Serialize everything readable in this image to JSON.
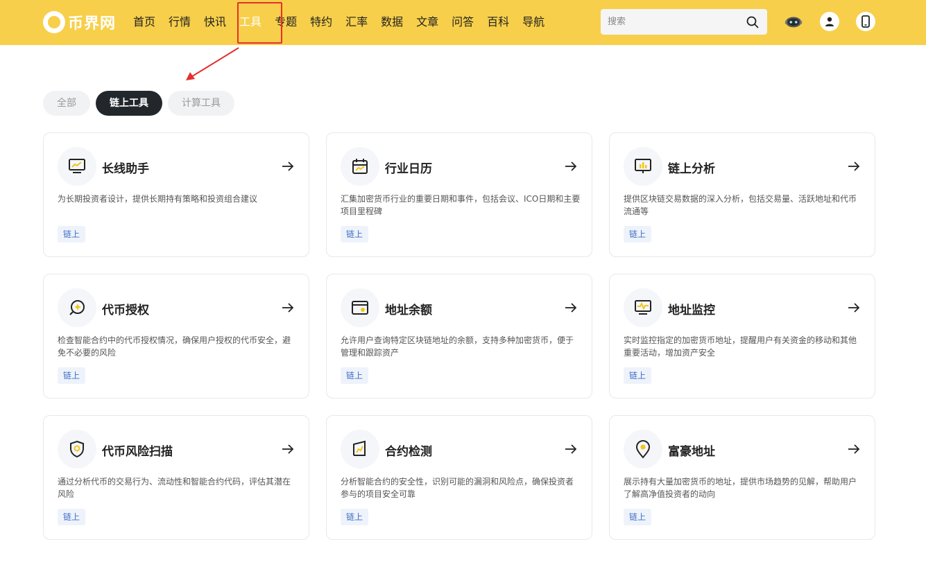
{
  "header": {
    "logo_text": "币界网",
    "nav": [
      {
        "label": "首页"
      },
      {
        "label": "行情"
      },
      {
        "label": "快讯"
      },
      {
        "label": "工具"
      },
      {
        "label": "专题"
      },
      {
        "label": "特约"
      },
      {
        "label": "汇率"
      },
      {
        "label": "数据"
      },
      {
        "label": "文章"
      },
      {
        "label": "问答"
      },
      {
        "label": "百科"
      },
      {
        "label": "导航"
      }
    ],
    "active_nav": "工具",
    "search_placeholder": "搜索",
    "icons": [
      "robot-icon",
      "user-icon",
      "mobile-icon"
    ]
  },
  "tabs": [
    {
      "label": "全部"
    },
    {
      "label": "链上工具"
    },
    {
      "label": "计算工具"
    }
  ],
  "active_tab": "链上工具",
  "cards": [
    {
      "title": "长线助手",
      "desc": "为长期投资者设计，提供长期持有策略和投资组合建议",
      "tag": "链上",
      "icon": "monitor-chart-icon"
    },
    {
      "title": "行业日历",
      "desc": "汇集加密货币行业的重要日期和事件，包括会议、ICO日期和主要项目里程碑",
      "tag": "链上",
      "icon": "calendar-icon"
    },
    {
      "title": "链上分析",
      "desc": "提供区块链交易数据的深入分析，包括交易量、活跃地址和代币流通等",
      "tag": "链上",
      "icon": "bar-chart-icon"
    },
    {
      "title": "代币授权",
      "desc": "检查智能合约中的代币授权情况，确保用户授权的代币安全，避免不必要的风险",
      "tag": "链上",
      "icon": "search-coin-icon"
    },
    {
      "title": "地址余额",
      "desc": "允许用户查询特定区块链地址的余额，支持多种加密货币，便于管理和跟踪资产",
      "tag": "链上",
      "icon": "wallet-icon"
    },
    {
      "title": "地址监控",
      "desc": "实时监控指定的加密货币地址，提醒用户有关资金的移动和其他重要活动，增加资产安全",
      "tag": "链上",
      "icon": "monitor-pulse-icon"
    },
    {
      "title": "代币风险扫描",
      "desc": "通过分析代币的交易行为、流动性和智能合约代码，评估其潜在风险",
      "tag": "链上",
      "icon": "shield-icon"
    },
    {
      "title": "合约检测",
      "desc": "分析智能合约的安全性，识别可能的漏洞和风险点，确保投资者参与的项目安全可靠",
      "tag": "链上",
      "icon": "contract-chart-icon"
    },
    {
      "title": "富豪地址",
      "desc": "展示持有大量加密货币的地址，提供市场趋势的见解，帮助用户了解高净值投资者的动向",
      "tag": "链上",
      "icon": "location-pin-icon"
    }
  ],
  "colors": {
    "header_bg": "#f7cf4a",
    "accent_yellow": "#f5c518",
    "tab_active_bg": "#22272b",
    "tag_text": "#3d6bc4",
    "highlight_red": "#e62e2e"
  }
}
